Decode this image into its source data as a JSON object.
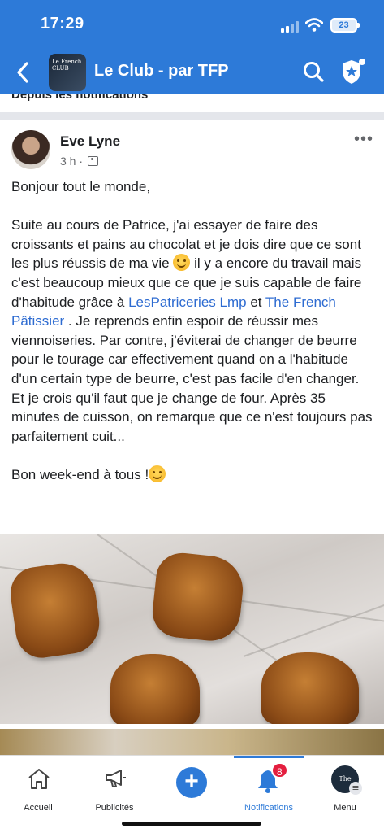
{
  "status_bar": {
    "time": "17:29",
    "battery": "23"
  },
  "header": {
    "group_logo_text": "Le French CLUB",
    "title": "Le Club - par TFP",
    "back_icon": "chevron-left-icon",
    "search_icon": "search-icon",
    "shield_icon": "shield-star-icon"
  },
  "section_label": "Depuis les notifications",
  "post": {
    "author": "Eve Lyne",
    "time": "3 h ·",
    "audience_icon": "group-icon",
    "paragraphs": {
      "p1": "Bonjour tout le monde,",
      "p2_a": "Suite au cours de Patrice, j'ai essayer de faire des croissants et pains au chocolat et je dois dire que ce sont les plus réussis de ma vie ",
      "p2_b": " il y a encore du travail mais c'est beaucoup mieux que ce que je suis capable de faire d'habitude grâce à ",
      "p2_link1": "LesPatriceries Lmp",
      "p2_c": "  et ",
      "p2_link2": "The French Pâtissier",
      "p2_d": " . Je reprends enfin espoir de réussir mes viennoiseries. Par contre, j'éviterai de changer de beurre pour le tourage car effectivement quand on a l'habitude d'un certain type de beurre, c'est pas facile d'en changer. Et je crois qu'il faut que je change de four. Après 35 minutes de cuisson, on remarque que ce n'est toujours pas parfaitement cuit...",
      "p3": "Bon week-end à tous !"
    }
  },
  "tabs": [
    {
      "label": "Accueil",
      "icon": "home-icon"
    },
    {
      "label": "Publicités",
      "icon": "megaphone-icon"
    },
    {
      "label": "",
      "icon": "plus-icon"
    },
    {
      "label": "Notifications",
      "icon": "bell-icon",
      "badge": "8"
    },
    {
      "label": "Menu",
      "icon": "menu-avatar-icon",
      "avatar_text": "The French"
    }
  ],
  "colors": {
    "brand": "#2d7ad8",
    "link": "#2d6bd1",
    "badge": "#e41e3f"
  }
}
